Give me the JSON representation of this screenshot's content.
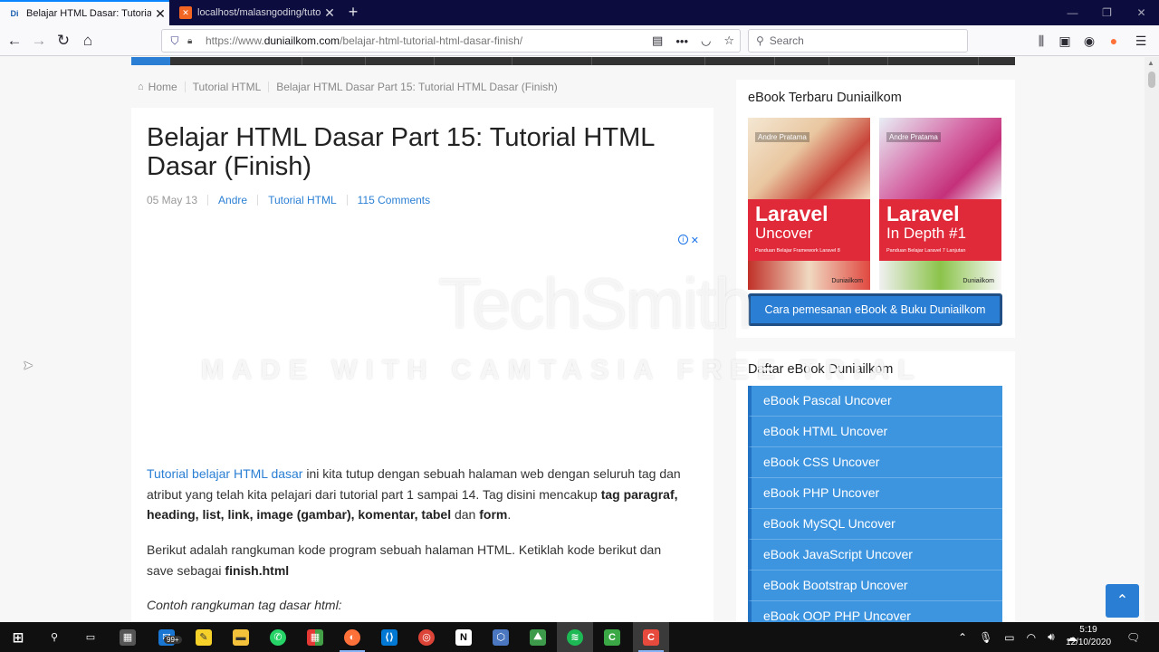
{
  "browser": {
    "tabs": [
      {
        "favicon": "Di",
        "title": "Belajar HTML Dasar: Tutorial HTML Dasar (Finish)"
      },
      {
        "favicon": "✕",
        "title": "localhost/malasngoding/tutorial"
      }
    ],
    "new_tab_label": "+",
    "url_protocol": "https://www.",
    "url_domain": "duniailkom.com",
    "url_path": "/belajar-html-tutorial-html-dasar-finish/",
    "search_placeholder": "Search"
  },
  "page": {
    "breadcrumb": [
      "Home",
      "Tutorial HTML",
      "Belajar HTML Dasar Part 15: Tutorial HTML Dasar (Finish)"
    ],
    "title": "Belajar HTML Dasar Part 15: Tutorial HTML Dasar (Finish)",
    "meta": {
      "date": "05 May 13",
      "author": "Andre",
      "category": "Tutorial HTML",
      "comments": "115 Comments"
    },
    "para1": {
      "link": "Tutorial belajar HTML dasar",
      "t1": " ini kita tutup dengan sebuah halaman web dengan seluruh tag dan atribut yang telah kita pelajari dari tutorial part 1 sampai 14. Tag disini mencakup ",
      "b1": "tag paragraf, heading, list, link, image (gambar), komentar, tabel",
      "t2": " dan ",
      "b2": "form",
      "t3": "."
    },
    "para2": {
      "t1": "Berikut adalah rangkuman kode program sebuah halaman HTML. Ketiklah kode berikut dan save sebagai ",
      "b1": "finish.html"
    },
    "para3": "Contoh rangkuman tag dasar html:"
  },
  "sidebar": {
    "ebook_title": "eBook Terbaru Duniailkom",
    "books": [
      {
        "author": "Andre Pratama",
        "name": "Laravel",
        "subtitle": "Uncover",
        "tagline": "Panduan Belajar Framework Laravel 8",
        "publisher": "Duniailkom"
      },
      {
        "author": "Andre Pratama",
        "name": "Laravel",
        "subtitle": "In Depth #1",
        "tagline": "Panduan Belajar Laravel 7 Lanjutan",
        "publisher": "Duniailkom"
      }
    ],
    "order_button": "Cara pemesanan eBook & Buku Duniailkom",
    "list_title": "Daftar eBook Duniailkom",
    "list": [
      "eBook Pascal Uncover",
      "eBook HTML Uncover",
      "eBook CSS Uncover",
      "eBook PHP Uncover",
      "eBook MySQL Uncover",
      "eBook JavaScript Uncover",
      "eBook Bootstrap Uncover",
      "eBook OOP PHP Uncover"
    ]
  },
  "watermark": {
    "brand": "TechSmith",
    "caption": "MADE WITH CAMTASIA FREE TRIAL"
  },
  "taskbar": {
    "badge": "99+",
    "time": "5:19",
    "date": "12/10/2020"
  }
}
